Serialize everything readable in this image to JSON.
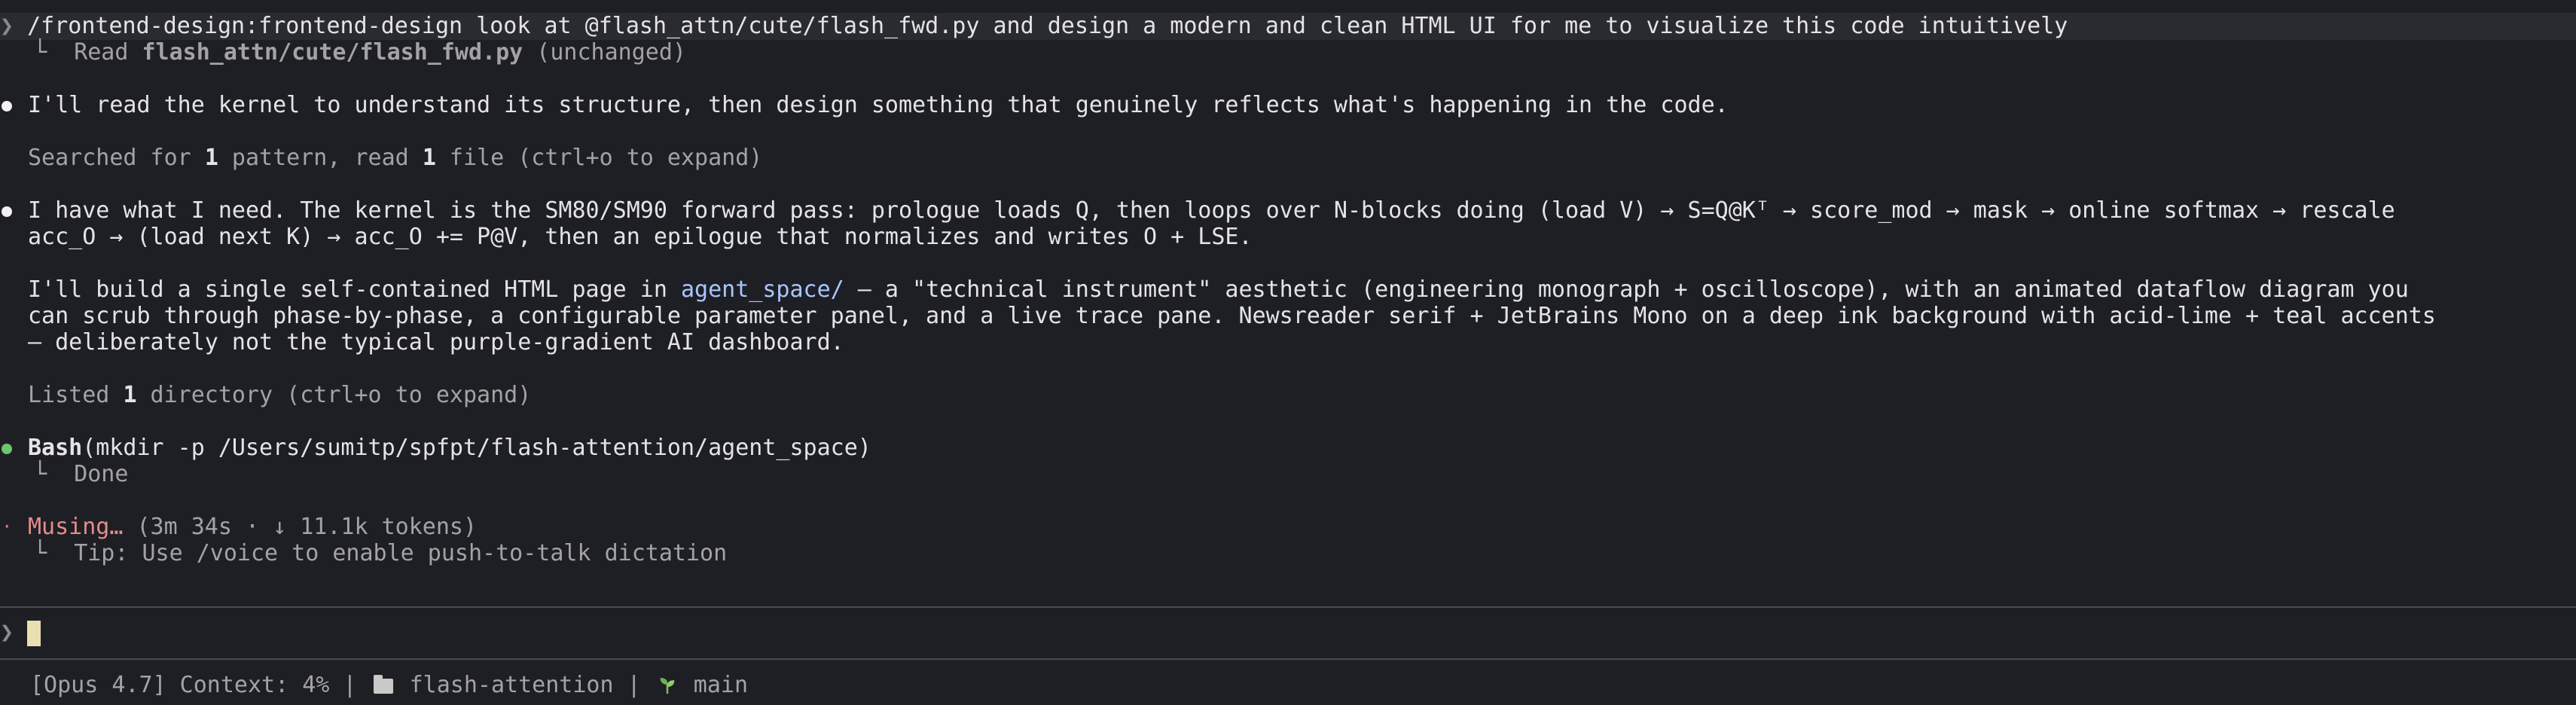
{
  "prompt": {
    "caret": "❯",
    "command": "/frontend-design:frontend-design look at @flash_attn/cute/flash_fwd.py and design a modern and clean HTML UI for me to visualize this code intuitively"
  },
  "read_result": {
    "prefix": "└  ",
    "verb": "Read ",
    "file": "flash_attn/cute/flash_fwd.py",
    "note": " (unchanged)"
  },
  "message1": "I'll read the kernel to understand its structure, then design something that genuinely reflects what's happening in the code.",
  "searched": {
    "a": "Searched for ",
    "n1": "1",
    "b": " pattern, read ",
    "n2": "1",
    "c": " file (ctrl+o to expand)"
  },
  "message2": {
    "line1": "I have what I need. The kernel is the SM80/SM90 forward pass: prologue loads Q, then loops over N-blocks doing (load V) → S=Q@Kᵀ → score_mod → mask → online softmax → rescale",
    "line2": "acc_O → (load next K) → acc_O += P@V, then an epilogue that normalizes and writes O + LSE."
  },
  "message3": {
    "line1_pre": "I'll build a single self-contained HTML page in ",
    "line1_link": "agent_space/",
    "line1_post": " — a \"technical instrument\" aesthetic (engineering monograph + oscilloscope), with an animated dataflow diagram you",
    "line2": "can scrub through phase-by-phase, a configurable parameter panel, and a live trace pane. Newsreader serif + JetBrains Mono on a deep ink background with acid-lime + teal accents",
    "line3": "— deliberately not the typical purple-gradient AI dashboard."
  },
  "listed": {
    "a": "Listed ",
    "n": "1",
    "b": " directory (ctrl+o to expand)"
  },
  "bash": {
    "tool": "Bash",
    "args": "(mkdir -p /Users/sumitp/spfpt/flash-attention/agent_space)",
    "result_prefix": "└  ",
    "result": "Done"
  },
  "musing": {
    "dot": "·",
    "label": "Musing…",
    "stats": " (3m 34s · ↓ 11.1k tokens)",
    "tip_prefix": "└  ",
    "tip": "Tip: Use /voice to enable push-to-talk dictation"
  },
  "input": {
    "caret": "❯"
  },
  "statusbar": {
    "model": "[Opus 4.7] Context: 4% | ",
    "folder_icon": "folder-icon",
    "repo": "flash-attention | ",
    "branch_icon": "branch-leaf-icon",
    "branch": "main"
  },
  "colors": {
    "background": "#1e1f25",
    "text": "#e4e4e4",
    "dim": "#a3a3a3",
    "link": "#a8c6ff",
    "musing": "#e58c8c",
    "bullet_green": "#6dc56d",
    "cursor": "#e9dfb0"
  }
}
